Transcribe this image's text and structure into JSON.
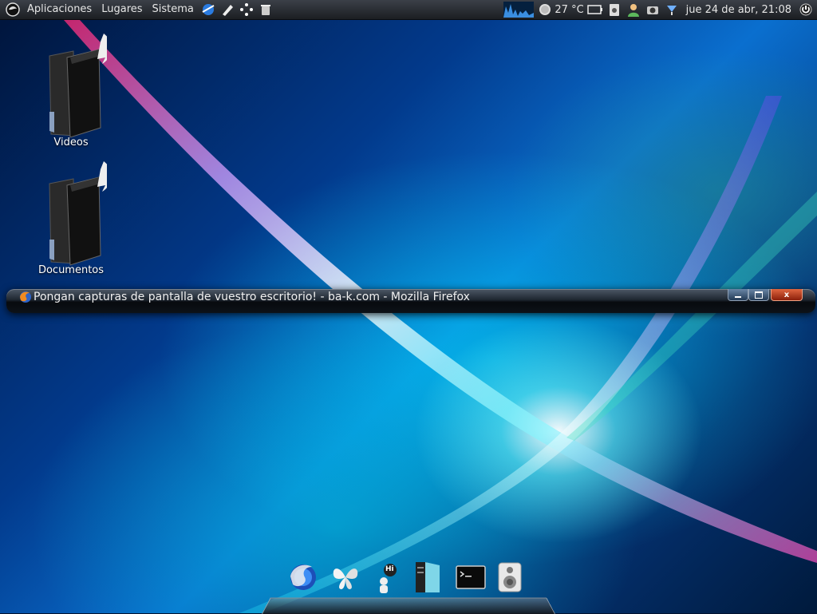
{
  "top_panel": {
    "menus": [
      "Aplicaciones",
      "Lugares",
      "Sistema"
    ],
    "weather_temp": "27 °C",
    "clock": "jue 24 de abr, 21:08"
  },
  "desktop": {
    "icons": [
      {
        "label": "Videos",
        "icon": "folder-icon"
      },
      {
        "label": "Documentos",
        "icon": "folder-icon"
      }
    ]
  },
  "window": {
    "title": "Pongan capturas de pantalla de vuestro escritorio! - ba-k.com - Mozilla Firefox",
    "close_glyph": "x"
  },
  "dock": {
    "items": [
      "firefox-icon",
      "butterfly-icon",
      "chat-icon",
      "book-icon",
      "terminal-icon",
      "speaker-icon"
    ],
    "chat_bubble_text": "Hi"
  },
  "colors": {
    "panel_bg": "#2a2e34",
    "close_button": "#c94a28",
    "accent_blue": "#0a6fcf"
  }
}
